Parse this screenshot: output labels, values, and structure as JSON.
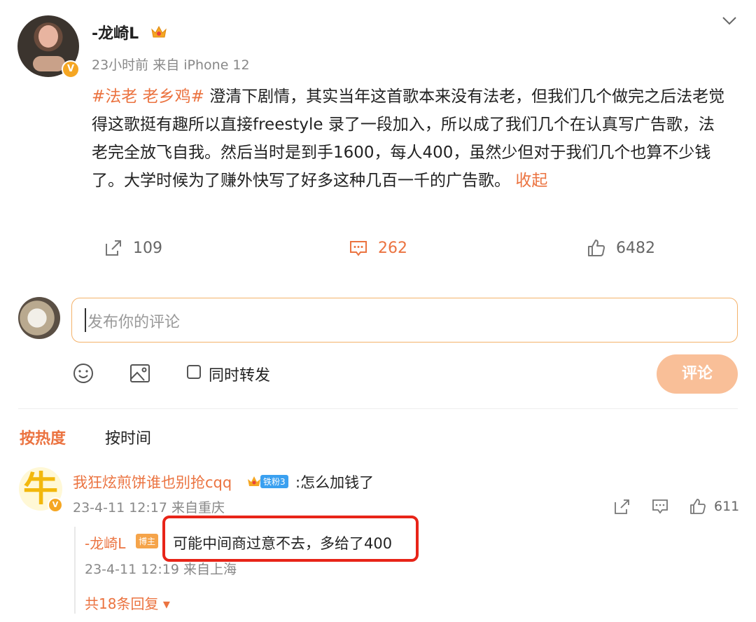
{
  "post": {
    "author": "-龙崎L",
    "meta": "23小时前 来自 iPhone 12",
    "hashtag": "#法老 老乡鸡#",
    "text": " 澄清下剧情，其实当年这首歌本来没有法老，但我们几个做完之后法老觉得这歌挺有趣所以直接freestyle 录了一段加入，所以成了我们几个在认真写广告歌，法老完全放飞自我。然后当时是到手1600，每人400，虽然少但对于我们几个也算不少钱了。大学时候为了赚外快写了好多这种几百一千的广告歌。",
    "collapse": "收起",
    "reposts": "109",
    "comments": "262",
    "likes": "6482"
  },
  "composer": {
    "placeholder": "发布你的评论",
    "repost_label": "同时转发",
    "submit_label": "评论"
  },
  "sort": {
    "hot": "按热度",
    "time": "按时间"
  },
  "comment": {
    "avatar_glyph": "牛",
    "user": "我狂炫煎饼谁也别抢cqq",
    "fan_badge": "铁粉3",
    "text": ":怎么加钱了",
    "time": "23-4-11 12:17 来自重庆",
    "likes": "611",
    "reply": {
      "user": "-龙崎L",
      "badge": "博主",
      "text": "可能中间商过意不去，多给了400",
      "time": "23-4-11 12:19 来自上海",
      "more": "共18条回复"
    }
  },
  "colors": {
    "accent": "#eb7340",
    "highlight": "#e82418",
    "submit_disabled": "#f9bf98"
  }
}
